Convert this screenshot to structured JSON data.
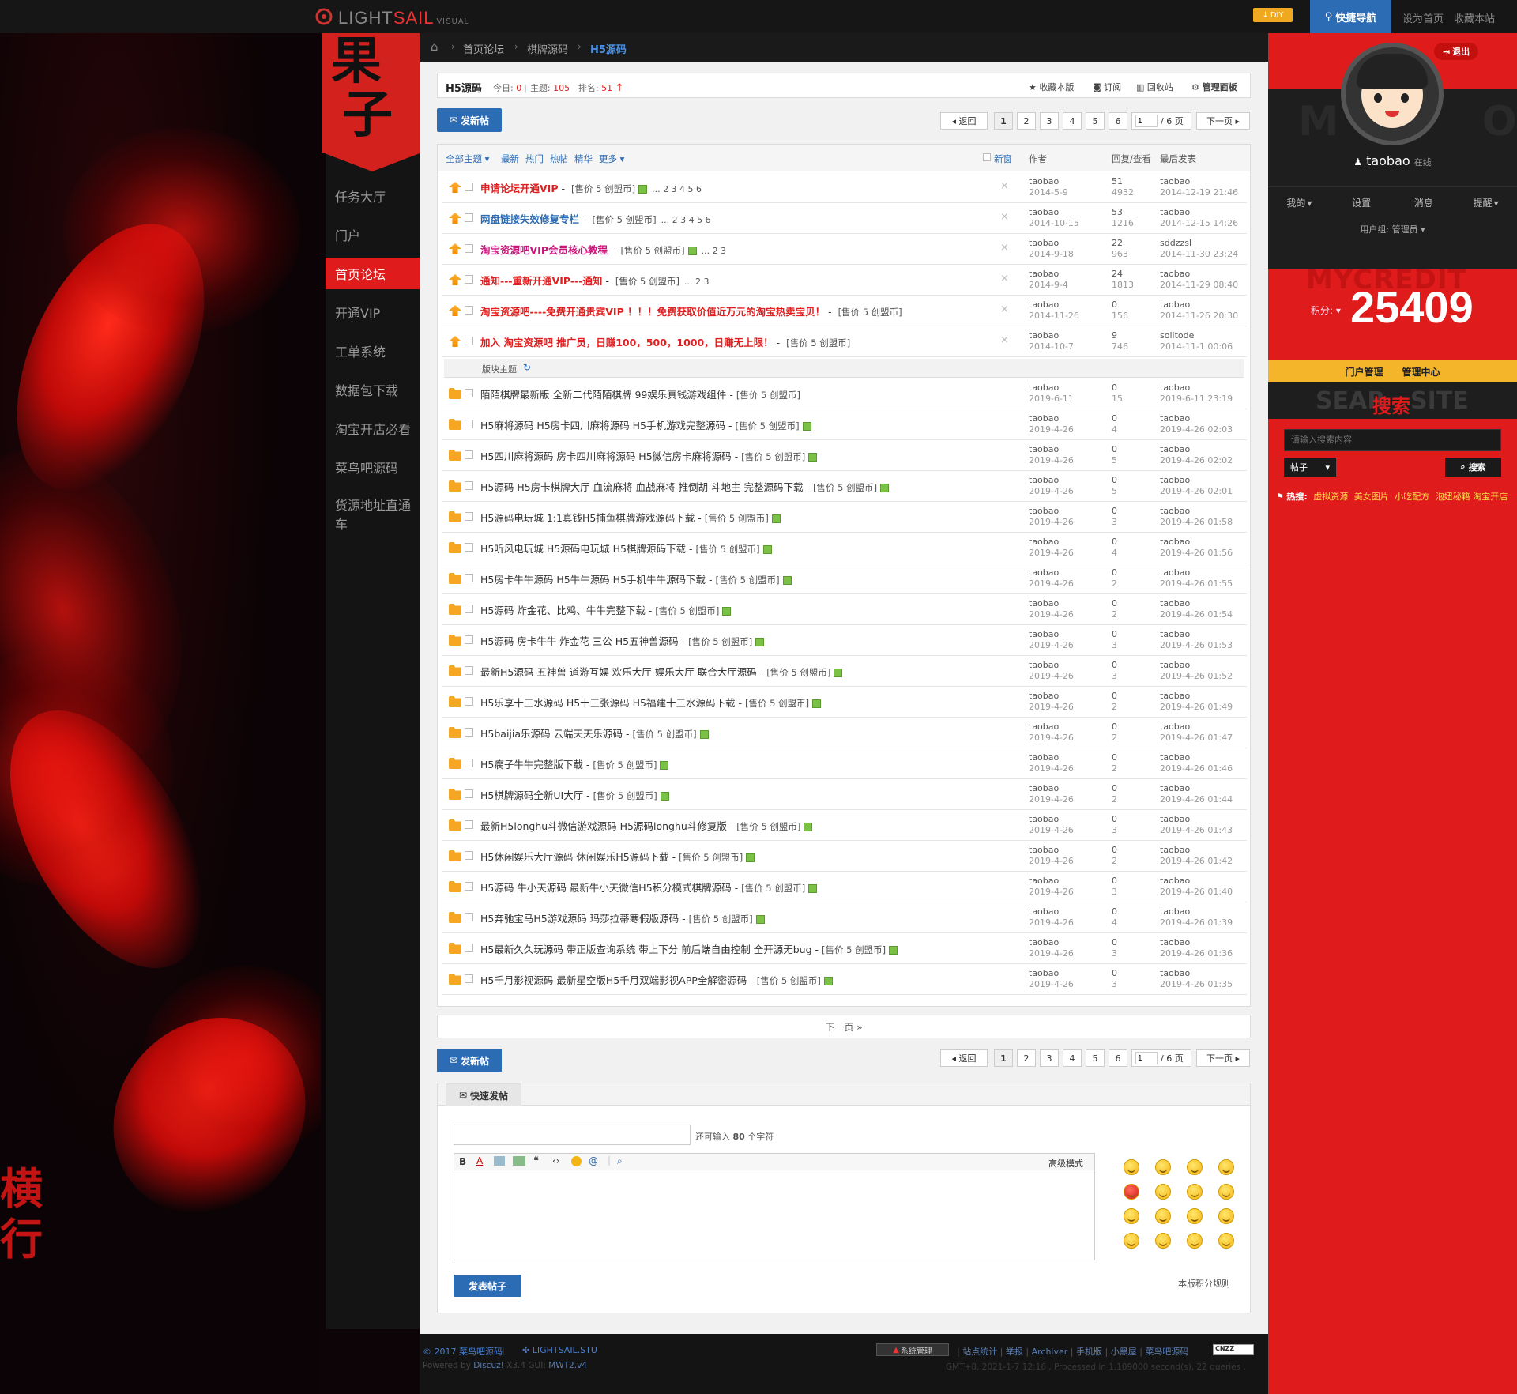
{
  "topbar": {
    "logo_a": "LIGHT",
    "logo_b": "SAIL",
    "logo_c": "VISUAL",
    "diy": "DIY",
    "quicknav": "快捷导航",
    "sethome": "设为首页",
    "favorite": "收藏本站"
  },
  "brand": {
    "line1": "果",
    "line2": "子"
  },
  "breadcrumb": [
    "首页论坛",
    "棋牌源码",
    "H5源码"
  ],
  "sidebar": [
    "任务大厅",
    "门户",
    "首页论坛",
    "开通VIP",
    "工单系统",
    "数据包下载",
    "淘宝开店必看",
    "菜鸟吧源码",
    "货源地址直通车"
  ],
  "sidebar_active": "首页论坛",
  "forum": {
    "name": "H5源码",
    "today_label": "今日:",
    "today": "0",
    "threads_label": "主题:",
    "threads": "105",
    "rank_label": "排名:",
    "rank": "51",
    "actions": [
      "收藏本版",
      "订阅",
      "回收站",
      "管理面板"
    ]
  },
  "new_post": "发新帖",
  "pager": {
    "back": "返回",
    "pages": [
      "1",
      "2",
      "3",
      "4",
      "5",
      "6"
    ],
    "input": "1",
    "total": "/ 6 页",
    "next": "下一页"
  },
  "filters": [
    "全部主题",
    "最新",
    "热门",
    "热帖",
    "精华",
    "更多"
  ],
  "newwin": "新窗",
  "headers": {
    "author": "作者",
    "replies": "回复/查看",
    "last": "最后发表"
  },
  "price_text": "[售价 5 创盟币]",
  "sticky": [
    {
      "title": "申请论坛开通VIP",
      "color": "#e02020",
      "pages": "... 2 3 4 5 6",
      "attach": true,
      "author": "taobao",
      "date": "2014-5-9",
      "replies": "51",
      "views": "4932",
      "last_user": "taobao",
      "last_time": "2014-12-19 21:46"
    },
    {
      "title": "网盘链接失效修复专栏",
      "color": "#2b6cb5",
      "pages": "... 2 3 4 5 6",
      "attach": false,
      "author": "taobao",
      "date": "2014-10-15",
      "replies": "53",
      "views": "1216",
      "last_user": "taobao",
      "last_time": "2014-12-15 14:26"
    },
    {
      "title": "淘宝资源吧VIP会员核心教程",
      "color": "#c8157a",
      "pages": "... 2 3",
      "attach": true,
      "author": "taobao",
      "date": "2014-9-18",
      "replies": "22",
      "views": "963",
      "last_user": "sddzzsl",
      "last_time": "2014-11-30 23:24"
    },
    {
      "title": "通知---重新开通VIP---通知",
      "color": "#e02020",
      "pages": "... 2 3",
      "attach": false,
      "author": "taobao",
      "date": "2014-9-4",
      "replies": "24",
      "views": "1813",
      "last_user": "taobao",
      "last_time": "2014-11-29 08:40"
    },
    {
      "title": "淘宝资源吧----免费开通贵宾VIP ！！！免费获取价值近万元的淘宝热卖宝贝！",
      "color": "#e02020",
      "pages": "",
      "attach": false,
      "author": "taobao",
      "date": "2014-11-26",
      "replies": "0",
      "views": "156",
      "last_user": "taobao",
      "last_time": "2014-11-26 20:30"
    },
    {
      "title": "加入 淘宝资源吧 推广员，日赚100，500，1000，日赚无上限！",
      "color": "#e02020",
      "pages": "",
      "attach": false,
      "author": "taobao",
      "date": "2014-10-7",
      "replies": "9",
      "views": "746",
      "last_user": "solitode",
      "last_time": "2014-11-1 00:06"
    }
  ],
  "section_label": "版块主题",
  "threads": [
    {
      "title": "陌陌棋牌最新版 全新二代陌陌棋牌 99娱乐真钱游戏组件",
      "attach": false,
      "date": "2019-6-11",
      "replies": "0",
      "views": "15",
      "last_time": "2019-6-11 23:19"
    },
    {
      "title": "H5麻将源码 H5房卡四川麻将源码 H5手机游戏完整源码",
      "attach": true,
      "date": "2019-4-26",
      "replies": "0",
      "views": "4",
      "last_time": "2019-4-26 02:03"
    },
    {
      "title": "H5四川麻将源码 房卡四川麻将源码 H5微信房卡麻将源码",
      "attach": true,
      "date": "2019-4-26",
      "replies": "0",
      "views": "5",
      "last_time": "2019-4-26 02:02"
    },
    {
      "title": "H5源码 H5房卡棋牌大厅 血流麻将 血战麻将 推倒胡 斗地主 完整源码下载",
      "attach": true,
      "date": "2019-4-26",
      "replies": "0",
      "views": "5",
      "last_time": "2019-4-26 02:01"
    },
    {
      "title": "H5源码电玩城 1:1真钱H5捕鱼棋牌游戏源码下载",
      "attach": true,
      "date": "2019-4-26",
      "replies": "0",
      "views": "3",
      "last_time": "2019-4-26 01:58"
    },
    {
      "title": "H5听风电玩城 H5源码电玩城 H5棋牌源码下载",
      "attach": true,
      "date": "2019-4-26",
      "replies": "0",
      "views": "4",
      "last_time": "2019-4-26 01:56"
    },
    {
      "title": "H5房卡牛牛源码 H5牛牛源码 H5手机牛牛源码下载",
      "attach": true,
      "date": "2019-4-26",
      "replies": "0",
      "views": "2",
      "last_time": "2019-4-26 01:55"
    },
    {
      "title": "H5源码 炸金花、比鸡、牛牛完整下载",
      "attach": true,
      "date": "2019-4-26",
      "replies": "0",
      "views": "2",
      "last_time": "2019-4-26 01:54"
    },
    {
      "title": "H5源码 房卡牛牛 炸金花 三公 H5五神兽源码",
      "attach": true,
      "date": "2019-4-26",
      "replies": "0",
      "views": "3",
      "last_time": "2019-4-26 01:53"
    },
    {
      "title": "最新H5源码 五神兽 道游互娱 欢乐大厅 娱乐大厅 联合大厅源码",
      "attach": true,
      "date": "2019-4-26",
      "replies": "0",
      "views": "3",
      "last_time": "2019-4-26 01:52"
    },
    {
      "title": "H5乐享十三水源码 H5十三张源码 H5福建十三水源码下载",
      "attach": true,
      "date": "2019-4-26",
      "replies": "0",
      "views": "2",
      "last_time": "2019-4-26 01:49"
    },
    {
      "title": "H5baijia乐源码 云端天天乐源码",
      "attach": true,
      "date": "2019-4-26",
      "replies": "0",
      "views": "2",
      "last_time": "2019-4-26 01:47"
    },
    {
      "title": "H5瘸子牛牛完整版下载",
      "attach": true,
      "date": "2019-4-26",
      "replies": "0",
      "views": "2",
      "last_time": "2019-4-26 01:46"
    },
    {
      "title": "H5棋牌源码全新UI大厅",
      "attach": true,
      "date": "2019-4-26",
      "replies": "0",
      "views": "2",
      "last_time": "2019-4-26 01:44"
    },
    {
      "title": "最新H5longhu斗微信游戏源码 H5源码longhu斗修复版",
      "attach": true,
      "date": "2019-4-26",
      "replies": "0",
      "views": "3",
      "last_time": "2019-4-26 01:43"
    },
    {
      "title": "H5休闲娱乐大厅源码 休闲娱乐H5源码下载",
      "attach": true,
      "date": "2019-4-26",
      "replies": "0",
      "views": "2",
      "last_time": "2019-4-26 01:42"
    },
    {
      "title": "H5源码 牛小天源码 最新牛小天微信H5积分模式棋牌源码",
      "attach": true,
      "date": "2019-4-26",
      "replies": "0",
      "views": "3",
      "last_time": "2019-4-26 01:40"
    },
    {
      "title": "H5奔驰宝马H5游戏源码 玛莎拉蒂寒假版源码",
      "attach": true,
      "date": "2019-4-26",
      "replies": "0",
      "views": "4",
      "last_time": "2019-4-26 01:39"
    },
    {
      "title": "H5最新久久玩源码 带正版查询系统 带上下分 前后端自由控制 全开源无bug",
      "attach": true,
      "date": "2019-4-26",
      "replies": "0",
      "views": "3",
      "last_time": "2019-4-26 01:36"
    },
    {
      "title": "H5千月影视源码 最新星空版H5千月双端影视APP全解密源码",
      "attach": true,
      "date": "2019-4-26",
      "replies": "0",
      "views": "3",
      "last_time": "2019-4-26 01:35"
    }
  ],
  "thread_author": "taobao",
  "nextpage_bar": "下一页 »",
  "quickpost": {
    "tab": "快速发帖",
    "hint_a": "还可输入",
    "hint_n": "80",
    "hint_b": "个字符",
    "advanced": "高级模式",
    "submit": "发表帖子",
    "rules": "本版积分规则"
  },
  "user": {
    "logout": "退出",
    "name": "taobao",
    "status": "在线",
    "menu": [
      "我的",
      "设置",
      "消息",
      "提醒"
    ],
    "group": "用户组: 管理员",
    "credit_label": "积分:",
    "credit": "25409",
    "mycredit_bg": "MYCREDIT",
    "admin_links": [
      "门户管理",
      "管理中心"
    ]
  },
  "search": {
    "bg_a": "SEAR",
    "bg_b": "SITE",
    "title": "搜索",
    "placeholder": "请输入搜索内容",
    "type": "帖子",
    "button": "搜索",
    "hot_label": "热搜:",
    "hot": [
      "虚拟资源",
      "美女图片",
      "小吃配方",
      "泡妞秘籍",
      "淘宝开店"
    ]
  },
  "footer": {
    "copyright": "© 2017 菜鸟吧源码",
    "brand": "LIGHTSAIL.STU",
    "powered_a": "Powered by",
    "powered_b": "Discuz!",
    "powered_c": "X3.4 GUI:",
    "powered_d": "MWT2.v4",
    "badge": "系统管理",
    "links": [
      "站点统计",
      "举报",
      "Archiver",
      "手机版",
      "小黑屋",
      "菜鸟吧源码"
    ],
    "cnzz": "CNZZ",
    "time": "GMT+8, 2021-1-7 12:16 , Processed in 1.109000 second(s), 22 queries ."
  },
  "left_art": {
    "text1": "横",
    "text2": "行"
  },
  "colors": {
    "accent_red": "#e01b1b",
    "blue": "#2b6cb5",
    "yellow": "#f4b52b"
  }
}
